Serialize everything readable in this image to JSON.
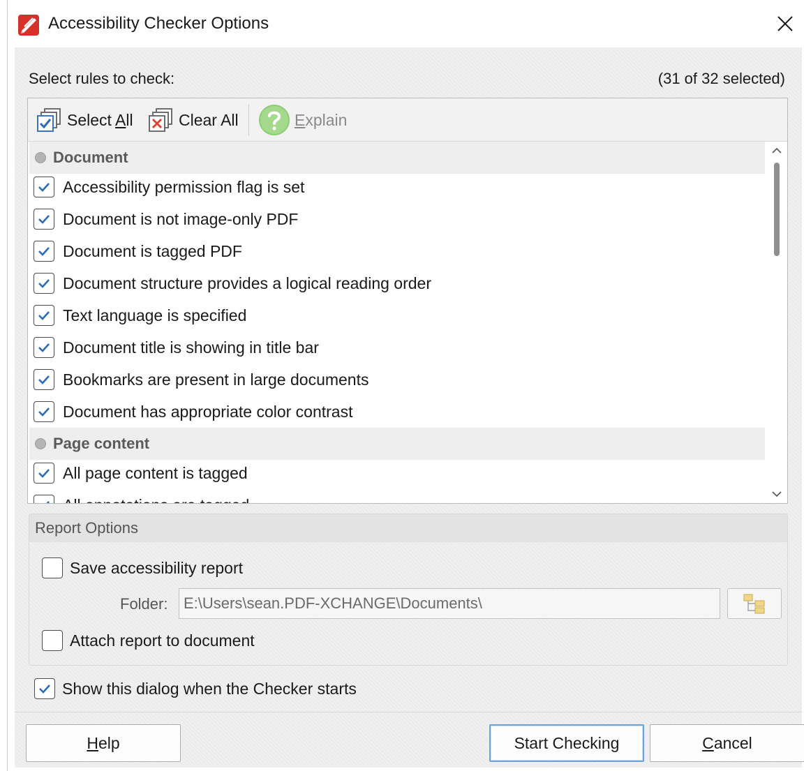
{
  "window": {
    "title": "Accessibility Checker Options"
  },
  "header": {
    "label": "Select rules to check:",
    "count": "(31 of 32 selected)"
  },
  "toolbar": {
    "select_all": {
      "pre": "Select ",
      "ul": "A",
      "post": "ll",
      "icon": "select-all-icon"
    },
    "clear_all": {
      "label": "Clear All",
      "icon": "clear-all-icon"
    },
    "explain": {
      "pre": "",
      "ul": "E",
      "post": "xplain",
      "icon": "help-icon",
      "disabled": true
    }
  },
  "rules": {
    "groups": [
      {
        "label": "Document",
        "items": [
          {
            "label": "Accessibility permission flag is set",
            "checked": true
          },
          {
            "label": "Document is not image-only PDF",
            "checked": true
          },
          {
            "label": "Document is tagged PDF",
            "checked": true
          },
          {
            "label": "Document structure provides a logical reading order",
            "checked": true
          },
          {
            "label": "Text language is specified",
            "checked": true
          },
          {
            "label": "Document title is showing in title bar",
            "checked": true
          },
          {
            "label": "Bookmarks are present in large documents",
            "checked": true
          },
          {
            "label": "Document has appropriate color contrast",
            "checked": true
          }
        ]
      },
      {
        "label": "Page content",
        "items": [
          {
            "label": "All page content is tagged",
            "checked": true
          },
          {
            "label": "All annotations are tagged",
            "checked": true
          }
        ]
      }
    ]
  },
  "report": {
    "title": "Report Options",
    "save_report": {
      "label": "Save accessibility report",
      "checked": false
    },
    "folder_label": "Folder:",
    "folder_value": "E:\\Users\\sean.PDF-XCHANGE\\Documents\\",
    "attach_report": {
      "label": "Attach report to document",
      "checked": false
    }
  },
  "show_dialog": {
    "label": "Show this dialog when the Checker starts",
    "checked": true
  },
  "buttons": {
    "help": {
      "ul": "H",
      "post": "elp"
    },
    "start": {
      "label": "Start Checking"
    },
    "cancel": {
      "ul": "C",
      "post": "ancel"
    }
  },
  "colors": {
    "check_mark": "#2b6cb8",
    "app_icon": "#d6302a"
  }
}
